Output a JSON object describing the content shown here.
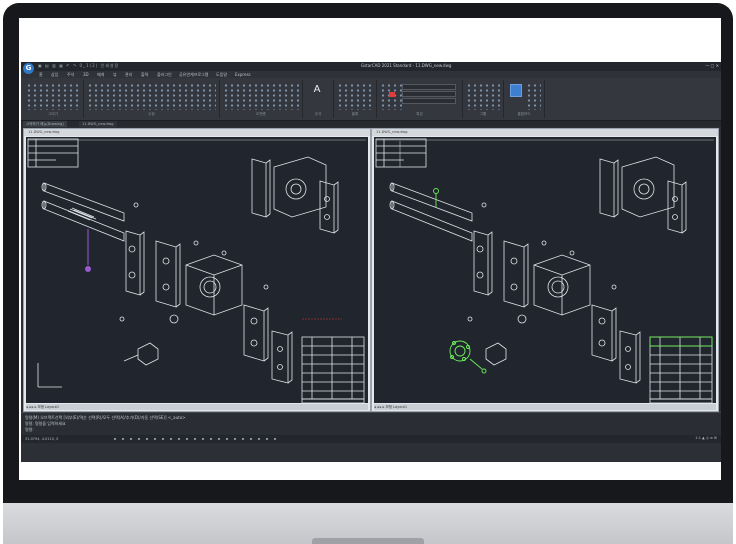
{
  "app": {
    "logo": "G",
    "title": "GstarCAD 2021 Standard - 11.DWG_new.dwg",
    "quick_access": "▣ ▤ ▥ ▦ ↶ ↷ 0_1(2) 인쇄설정"
  },
  "menu": [
    "홈",
    "삽입",
    "주석",
    "3D",
    "매개",
    "뷰",
    "관리",
    "출력",
    "플러그인",
    "공유연계프로그램",
    "도움말",
    "Express"
  ],
  "ribbon_panels": [
    "그리기",
    "수정",
    "도면층",
    "주석",
    "블록",
    "특성",
    "그룹",
    "클립보드"
  ],
  "document_tabs": [
    "시작하기 메뉴(Drawing)",
    "11.DWG_new.dwg"
  ],
  "viewports": [
    {
      "title": "11.DWG_new.dwg",
      "layout_tabs": "◂ ◂ ▸ ▸ 모형 Layout1"
    },
    {
      "title": "11.DWG_new.dwg",
      "layout_tabs": "◂ ◂ ▸ ▸ 모형 Layout1"
    }
  ],
  "command_lines": [
    "명령(M) 오브젝트선택 [외부(E)/역순 선택(R)/모두 선택(A)/추가(D)/자동 선택(SE)] <_auto>",
    "명령: 명령을 입력하세요",
    "명령:"
  ],
  "status": {
    "coords": "31.0794, 4.0110, 0",
    "right": "1:1 ▲ ◎ ≡ ⊞"
  },
  "colors": {
    "canvas": "#21252d",
    "line": "#e3e6ea",
    "highlight_purple": "#9b59d0",
    "highlight_green": "#6ef05a",
    "annotation_red": "#e23b3b"
  }
}
